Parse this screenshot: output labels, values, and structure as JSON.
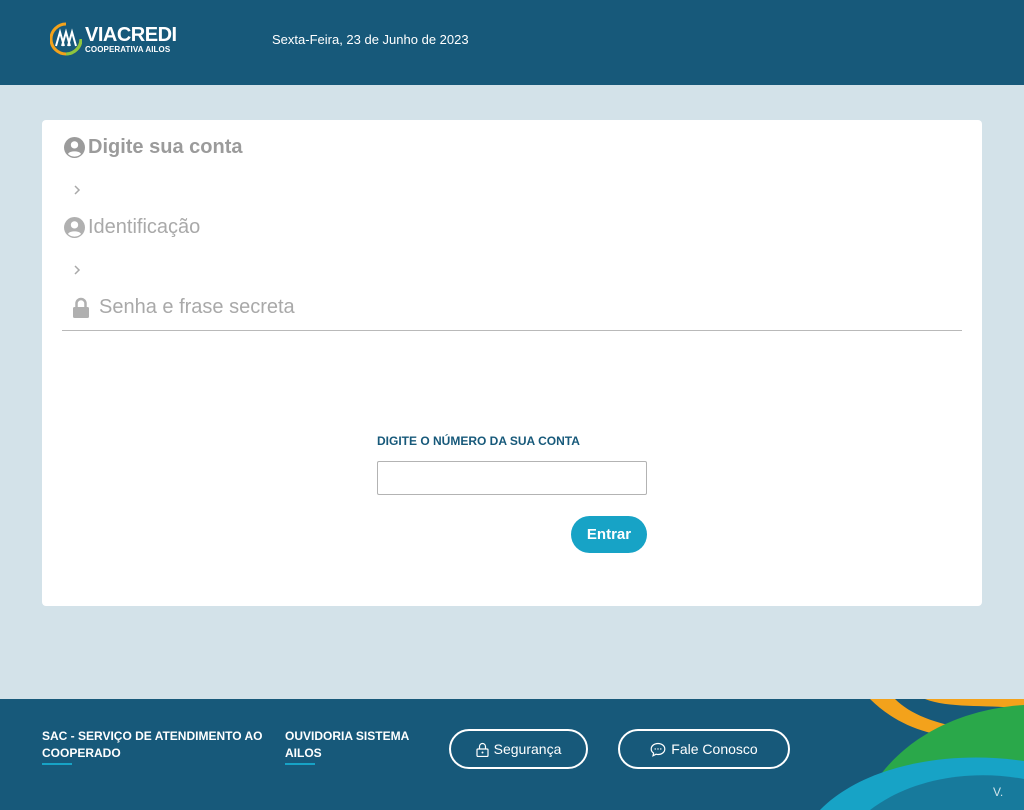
{
  "header": {
    "logo": {
      "brand": "VIACREDI",
      "subtitle": "COOPERATIVA AILOS"
    },
    "date": "Sexta-Feira, 23 de Junho de 2023"
  },
  "steps": [
    {
      "label": "Digite sua conta",
      "icon": "user-circle-icon",
      "active": true
    },
    {
      "label": "Identificação",
      "icon": "user-circle-icon",
      "active": false
    },
    {
      "label": "Senha e frase secreta",
      "icon": "lock-icon",
      "active": false
    }
  ],
  "form": {
    "account_label": "DIGITE O NÚMERO DA SUA CONTA",
    "account_value": "",
    "submit_label": "Entrar"
  },
  "footer": {
    "sac_link": "SAC - SERVIÇO DE ATENDIMENTO AO COOPERADO",
    "ouvidoria_link": "OUVIDORIA SISTEMA AILOS",
    "security_button": "Segurança",
    "contact_button": "Fale Conosco",
    "version": "V."
  },
  "colors": {
    "header_bg": "#17597a",
    "page_bg": "#d3e2e9",
    "accent": "#17a3c6",
    "step_inactive": "#a9a9a9"
  }
}
